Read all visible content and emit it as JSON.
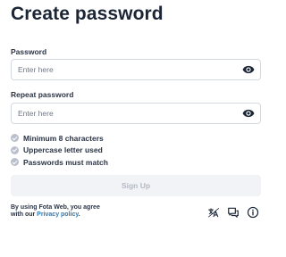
{
  "page": {
    "title": "Create password"
  },
  "password": {
    "label": "Password",
    "placeholder": "Enter here"
  },
  "repeat_password": {
    "label": "Repeat password",
    "placeholder": "Enter here"
  },
  "requirements": [
    {
      "text": "Minimum 8 characters"
    },
    {
      "text": "Uppercase letter used"
    },
    {
      "text": "Passwords must match"
    }
  ],
  "signup": {
    "label": "Sign Up"
  },
  "terms": {
    "line1": "By using Fota Web, you agree",
    "line2_prefix": "with our ",
    "link": "Privacy policy",
    "suffix": "."
  },
  "icons": {
    "visibility": "eye-icon",
    "footer": [
      "language-icon",
      "feedback-icon",
      "info-icon"
    ]
  },
  "colors": {
    "link": "#2a7ab8",
    "check": "#b9c0cb",
    "button_bg": "#f1f3f6",
    "button_text": "#b3b9c3"
  }
}
